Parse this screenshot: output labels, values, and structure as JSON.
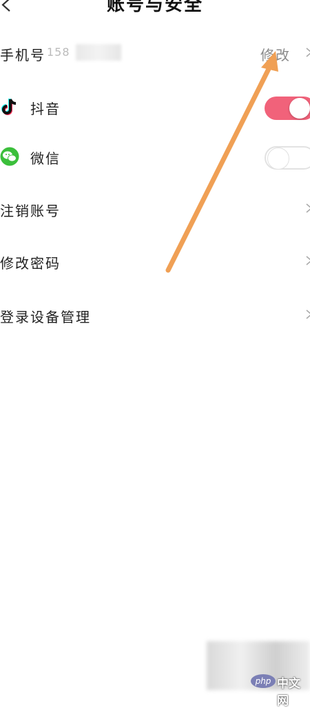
{
  "header": {
    "title": "账号与安全"
  },
  "phone": {
    "label": "手机号",
    "masked_number": "158",
    "edit_label": "修改"
  },
  "accounts": [
    {
      "name": "抖音",
      "icon": "tiktok-icon",
      "enabled": true
    },
    {
      "name": "微信",
      "icon": "wechat-icon",
      "enabled": false
    }
  ],
  "menu": [
    {
      "label": "注销账号"
    },
    {
      "label": "修改密码"
    },
    {
      "label": "登录设备管理"
    }
  ],
  "colors": {
    "toggle_on": "#f1627a",
    "annotation_arrow": "#f0a055",
    "wechat": "#3bbf3b"
  },
  "watermark": {
    "logo_text": "php",
    "text": "中文网"
  }
}
